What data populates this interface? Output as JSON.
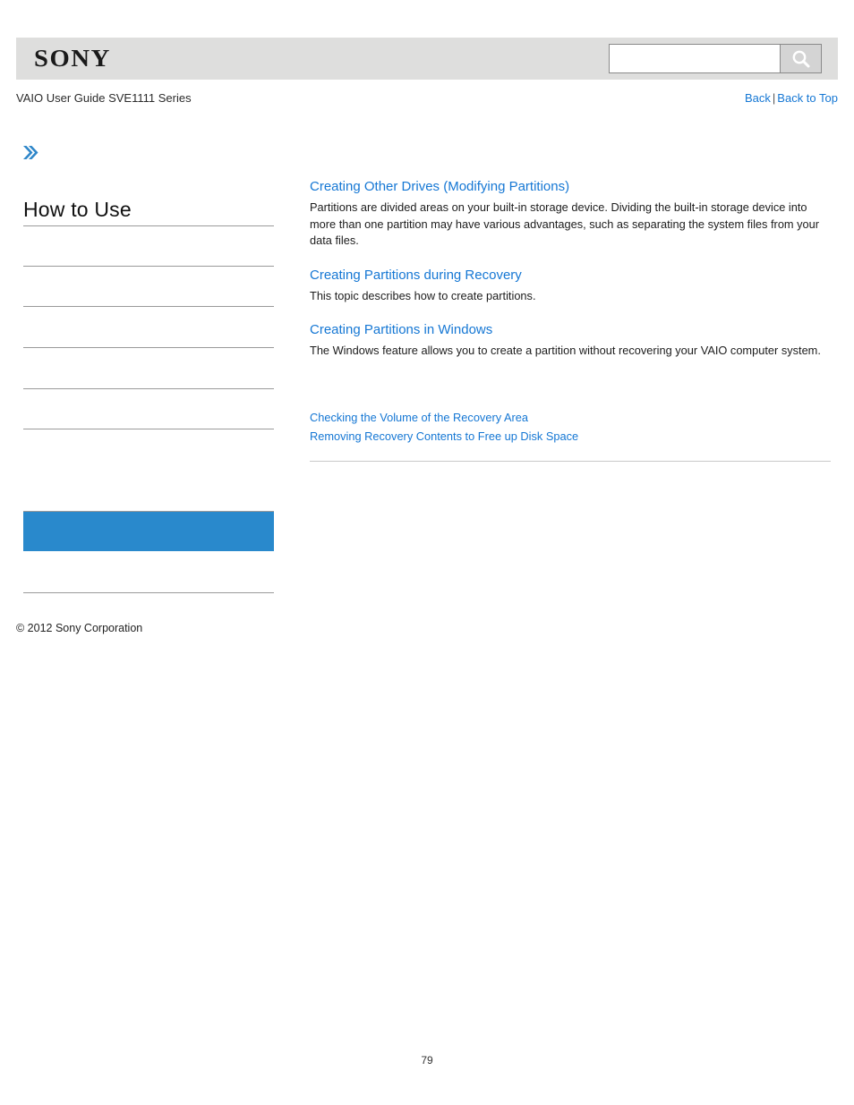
{
  "header": {
    "logo_text": "SONY",
    "search": {
      "value": "",
      "placeholder": "",
      "icon": "search-icon"
    }
  },
  "subheader": {
    "guide_title": "VAIO User Guide SVE1111 Series",
    "nav": {
      "back_label": "Back",
      "separator": "|",
      "back_to_top_label": "Back to Top"
    }
  },
  "sidebar": {
    "expand_icon": "double-chevron-right-icon",
    "heading": "How to Use",
    "items": [
      {
        "label": "",
        "selected": false
      },
      {
        "label": "",
        "selected": false
      },
      {
        "label": "",
        "selected": false
      },
      {
        "label": "",
        "selected": false
      },
      {
        "label": "",
        "selected": false
      },
      {
        "label": "",
        "selected": false
      },
      {
        "label": "",
        "selected": false
      },
      {
        "label": "",
        "selected": true
      },
      {
        "label": "",
        "selected": false
      },
      {
        "label": "",
        "selected": false
      }
    ]
  },
  "main": {
    "topics": [
      {
        "link": "Creating Other Drives (Modifying Partitions)",
        "description": "Partitions are divided areas on your built-in storage device. Dividing the built-in storage device into more than one partition may have various advantages, such as separating the system files from your data files."
      },
      {
        "link": "Creating Partitions during Recovery",
        "description": "This topic describes how to create partitions."
      },
      {
        "link": "Creating Partitions in Windows",
        "description": "The Windows feature allows you to create a partition without recovering your VAIO computer system."
      }
    ],
    "related_links": [
      "Checking the Volume of the Recovery Area",
      "Removing Recovery Contents to Free up Disk Space"
    ]
  },
  "footer": {
    "copyright": "© 2012 Sony Corporation",
    "page_number": "79"
  },
  "colors": {
    "link_blue": "#1577d4",
    "selected_blue": "#2989cc",
    "header_gray": "#dededd",
    "rule_gray": "#9a9a9a"
  }
}
